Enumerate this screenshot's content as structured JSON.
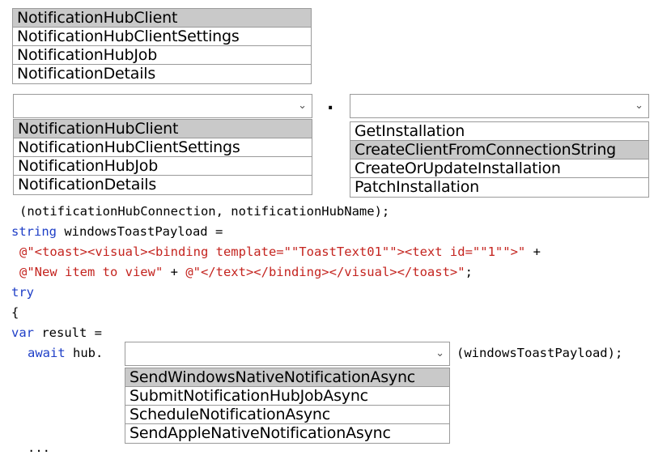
{
  "list1": {
    "items": [
      "NotificationHubClient",
      "NotificationHubClientSettings",
      "NotificationHubJob",
      "NotificationDetails"
    ],
    "selected": 0
  },
  "list2": {
    "items": [
      "NotificationHubClient",
      "NotificationHubClientSettings",
      "NotificationHubJob",
      "NotificationDetails"
    ],
    "selected": 0
  },
  "separator": ".",
  "list3": {
    "items": [
      "GetInstallation",
      "CreateClientFromConnectionString",
      "CreateOrUpdateInstallation",
      "PatchInstallation"
    ],
    "selected": 1
  },
  "list4": {
    "items": [
      "SendWindowsNativeNotificationAsync",
      "SubmitNotificationHubJobAsync",
      "ScheduleNotificationAsync",
      "SendAppleNativeNotificationAsync"
    ],
    "selected": 0
  },
  "code": {
    "line1": "(notificationHubConnection, notificationHubName);",
    "line2_kw": "string",
    "line2_rest": " windowsToastPayload =",
    "line3_str": "@\"<toast><visual><binding template=\"\"ToastText01\"\"><text id=\"\"1\"\">\"",
    "line3_rest": " +",
    "line4_str1": "@\"New item to view\"",
    "line4_mid": " + ",
    "line4_str2": "@\"</text></binding></visual></toast>\"",
    "line4_end": ";",
    "line5_kw": "try",
    "line6": "{",
    "line7_kw": "var",
    "line7_rest": " result =",
    "line8_kw": "await",
    "line8_rest": " hub.",
    "line8_tail": "(windowsToastPayload);",
    "line9": "..."
  },
  "icons": {
    "chevron": "chevron-down-icon"
  }
}
